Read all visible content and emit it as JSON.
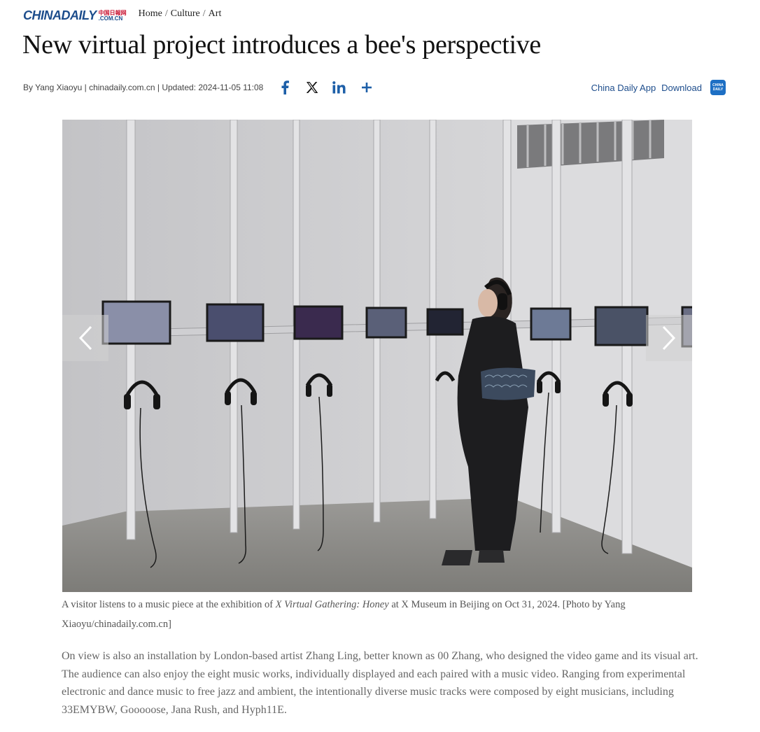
{
  "site": {
    "logo_main": "CHINADAILY",
    "logo_cn": "中国日報网",
    "logo_com": ".COM.CN"
  },
  "breadcrumb": {
    "home": "Home",
    "culture": "Culture",
    "art": "Art",
    "separator": "/"
  },
  "article": {
    "title": "New virtual project introduces a bee's perspective",
    "byline": "By Yang Xiaoyu | chinadaily.com.cn | Updated: 2024-11-05 11:08",
    "caption_before": "A visitor listens to a music piece at the exhibition of ",
    "caption_em": "X Virtual Gathering: Honey",
    "caption_after": " at X Museum in Beijing on Oct 31, 2024. [Photo by Yang Xiaoyu/chinadaily.com.cn]",
    "paragraph": "On view is also an installation by London-based artist Zhang Ling, better known as 00 Zhang, who designed the video game and its visual art. The audience can also enjoy the eight music works, individually displayed and each paired with a music video. Ranging from experimental electronic and dance music to free jazz and ambient, the intentionally diverse music tracks were composed by eight musicians, including 33EMYBW, Gooooose, Jana Rush, and Hyph11E."
  },
  "share_icons": [
    "facebook-icon",
    "x-icon",
    "linkedin-icon",
    "plus-icon"
  ],
  "app": {
    "label": "China Daily App",
    "download": "Download",
    "icon_line1": "CHINA",
    "icon_line2": "DAILY"
  },
  "colors": {
    "brand": "#1d4d8c",
    "share": "#1d5fa8",
    "caption": "#555555",
    "body": "#666666"
  }
}
